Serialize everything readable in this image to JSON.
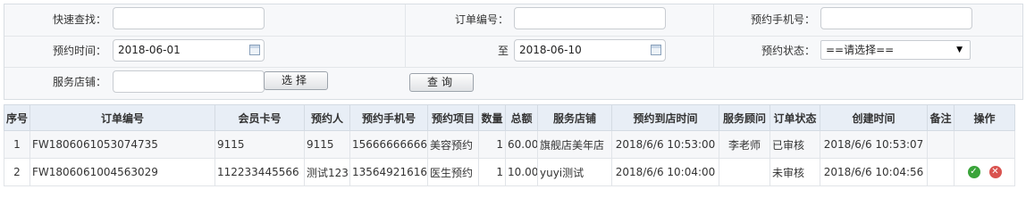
{
  "filters": {
    "quick_search_label": "快速查找：",
    "order_no_label": "订单编号：",
    "phone_label": "预约手机号：",
    "time_label": "预约时间：",
    "date_from": "2018-06-01",
    "to_label": "至",
    "date_to": "2018-06-10",
    "status_label": "预约状态：",
    "status_value": "==请选择==",
    "store_label": "服务店铺：",
    "select_button": "选择",
    "query_button": "查询"
  },
  "table": {
    "headers": [
      "序号",
      "订单编号",
      "会员卡号",
      "预约人",
      "预约手机号",
      "预约项目",
      "数量",
      "总额",
      "服务店铺",
      "预约到店时间",
      "服务顾问",
      "订单状态",
      "创建时间",
      "备注",
      "操作"
    ],
    "rows": [
      [
        "1",
        "FW1806061053074735",
        "9115",
        "9115",
        "15666666666",
        "美容预约",
        "1",
        "60.00",
        "旗舰店美年店",
        "2018/6/6 10:53:00",
        "李老师",
        "已审核",
        "2018/6/6 10:53:07",
        ""
      ],
      [
        "2",
        "FW1806061004563029",
        "112233445566",
        "测试123",
        "13564921616",
        "医生预约",
        "1",
        "10.00",
        "yuyi测试",
        "2018/6/6 10:04:00",
        "",
        "未审核",
        "2018/6/6 10:04:56",
        ""
      ]
    ]
  },
  "icons": {
    "approve": "check-circle-icon",
    "reject": "close-circle-icon",
    "calendar": "calendar-icon"
  }
}
